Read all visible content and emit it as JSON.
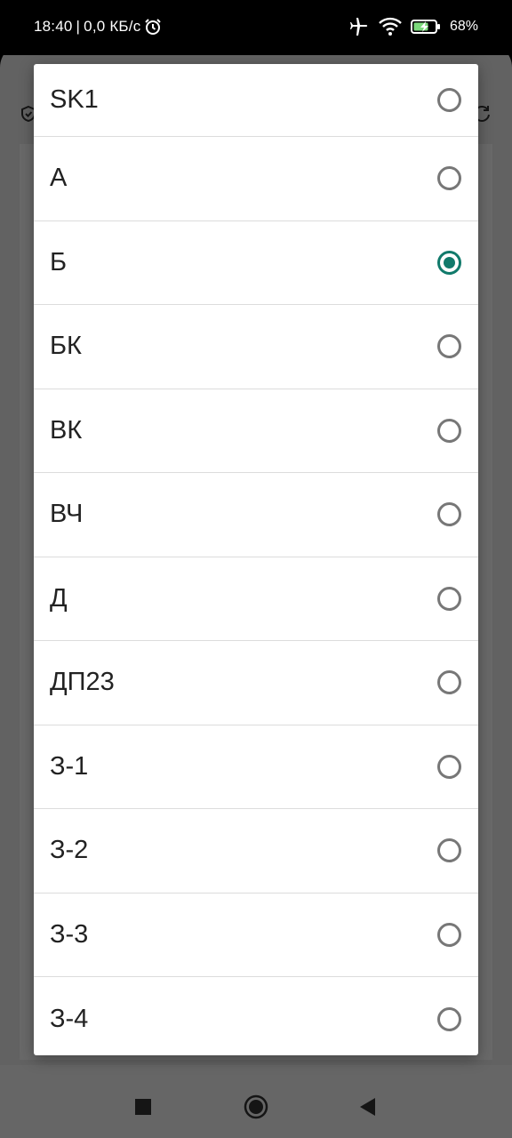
{
  "status_bar": {
    "time": "18:40",
    "separator": "|",
    "network_speed": "0,0 КБ/с",
    "battery_percent": "68%",
    "icons": [
      "alarm-icon",
      "airplane-icon",
      "wifi-icon",
      "battery-charging-icon"
    ]
  },
  "dialog": {
    "selected_index": 2,
    "accent_color": "#117a6b",
    "options": [
      {
        "label": "SK1",
        "checked": false
      },
      {
        "label": "А",
        "checked": false
      },
      {
        "label": "Б",
        "checked": true
      },
      {
        "label": "БК",
        "checked": false
      },
      {
        "label": "ВК",
        "checked": false
      },
      {
        "label": "ВЧ",
        "checked": false
      },
      {
        "label": "Д",
        "checked": false
      },
      {
        "label": "ДП23",
        "checked": false
      },
      {
        "label": "З-1",
        "checked": false
      },
      {
        "label": "З-2",
        "checked": false
      },
      {
        "label": "З-3",
        "checked": false
      },
      {
        "label": "З-4",
        "checked": false
      }
    ]
  },
  "nav_bar": {
    "icons": [
      "recents-square-icon",
      "home-circle-icon",
      "back-triangle-icon"
    ]
  }
}
